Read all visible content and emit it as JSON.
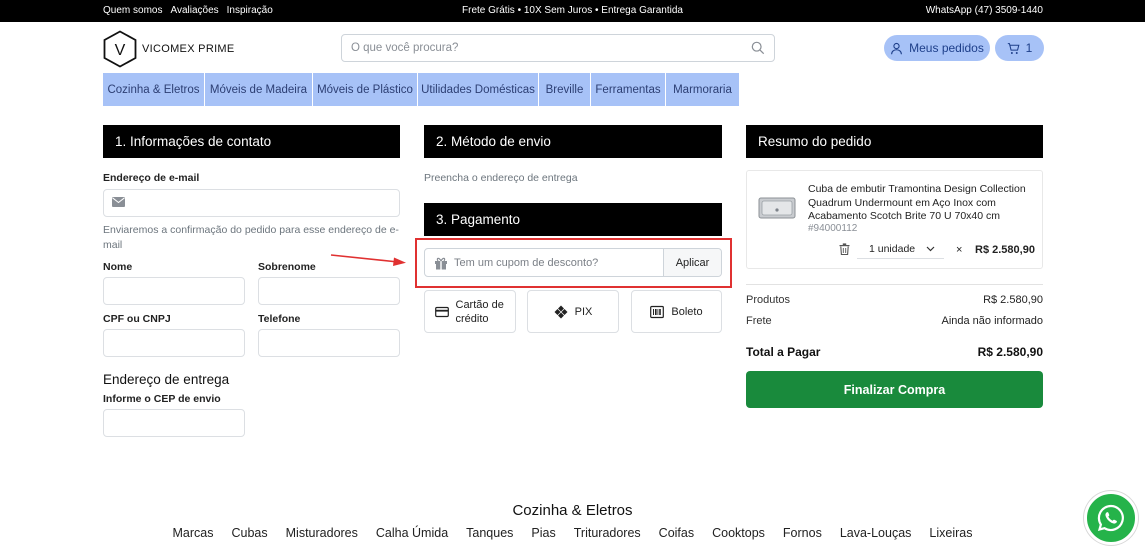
{
  "topbar": {
    "links": [
      "Quem somos",
      "Avaliações",
      "Inspiração"
    ],
    "promo": "Frete Grátis • 10X Sem Juros • Entrega Garantida",
    "whatsapp": "WhatsApp (47) 3509-1440"
  },
  "header": {
    "logo_letter": "V",
    "brand": "VICOMEX PRIME",
    "search_placeholder": "O que você procura?",
    "orders_label": "Meus pedidos",
    "cart_count": "1",
    "accent_color": "#a7c2f7"
  },
  "categories": [
    "Cozinha & Eletros",
    "Móveis de Madeira",
    "Móveis de Plástico",
    "Utilidades Domésticas",
    "Breville",
    "Ferramentas",
    "Marmoraria"
  ],
  "contact": {
    "title": "1. Informações de contato",
    "email_label": "Endereço de e-mail",
    "email_help": "Enviaremos a confirmação do pedido para esse endereço de e-mail",
    "first_name_label": "Nome",
    "last_name_label": "Sobrenome",
    "document_label": "CPF ou CNPJ",
    "phone_label": "Telefone",
    "address_title": "Endereço de entrega",
    "zip_label": "Informe o CEP de envio"
  },
  "shipping": {
    "title": "2. Método de envio",
    "hint": "Preencha o endereço de entrega"
  },
  "payment": {
    "title": "3. Pagamento",
    "coupon_placeholder": "Tem um cupom de desconto?",
    "apply_label": "Aplicar",
    "methods": [
      "Cartão de crédito",
      "PIX",
      "Boleto"
    ]
  },
  "summary": {
    "title": "Resumo do pedido",
    "item": {
      "name": "Cuba de embutir Tramontina Design Collection Quadrum Undermount em Aço Inox com Acabamento Scotch Brite 70 U 70x40 cm",
      "sku": "#94000112",
      "quantity": "1 unidade",
      "times": "×",
      "price": "R$ 2.580,90"
    },
    "products_label": "Produtos",
    "products_value": "R$ 2.580,90",
    "shipping_label": "Frete",
    "shipping_value": "Ainda não informado",
    "total_label": "Total a Pagar",
    "total_value": "R$ 2.580,90",
    "finish_label": "Finalizar Compra",
    "finish_color": "#198a3c"
  },
  "footer": {
    "title": "Cozinha & Eletros",
    "links": [
      "Marcas",
      "Cubas",
      "Misturadores",
      "Calha Úmida",
      "Tanques",
      "Pias",
      "Trituradores",
      "Coifas",
      "Cooktops",
      "Fornos",
      "Lava-Louças",
      "Lixeiras"
    ]
  }
}
